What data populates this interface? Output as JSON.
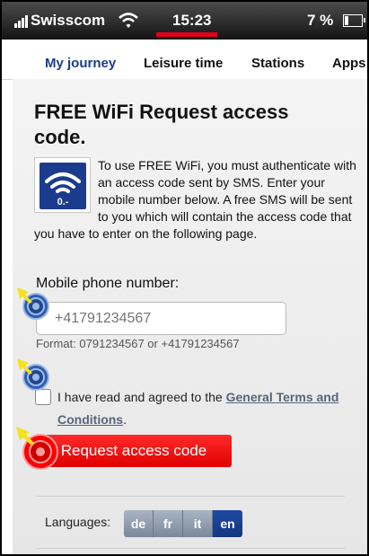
{
  "status_bar": {
    "carrier": "Swisscom",
    "time": "15:23",
    "battery": "7 %"
  },
  "nav": {
    "tabs": [
      "My journey",
      "Leisure time",
      "Stations",
      "Apps"
    ],
    "active_tab": "My journey"
  },
  "page": {
    "title": "FREE WiFi Request access code.",
    "wifi_icon_caption": "0.-",
    "intro_text": "To use FREE WiFi, you must authenticate with an access code sent by SMS. Enter your mobile number below. A free SMS will be sent to you which will contain the access code that you have to enter on the following page.",
    "intro_part1": "To use FREE WiFi, you must authenticate with an access code sent by SMS. Enter your mobile number below. A free SMS will be sent to you which will contain the ",
    "intro_part2": "access code that you have to enter on the following page.",
    "phone_label": "Mobile phone number:",
    "phone_placeholder": "+41791234567",
    "phone_value": "",
    "format_hint": "Format: 0791234567 or +41791234567",
    "terms_prefix": "I have read and agreed to the ",
    "terms_link": "General Terms and Conditions",
    "terms_suffix": ".",
    "terms_checked": false,
    "request_button": "Request access code",
    "languages_label": "Languages:",
    "languages": [
      "de",
      "fr",
      "it",
      "en"
    ],
    "active_language": "en"
  },
  "colors": {
    "brand_red": "#e2001a",
    "nav_active": "#1b3c8c",
    "button_red": "#ee0000",
    "lang_active": "#1a3f93",
    "lang_inactive": "#8e9aab"
  },
  "annotations": [
    {
      "target": "phone-input",
      "style": "blue"
    },
    {
      "target": "terms-checkbox",
      "style": "blue"
    },
    {
      "target": "request-access-button",
      "style": "red"
    }
  ]
}
